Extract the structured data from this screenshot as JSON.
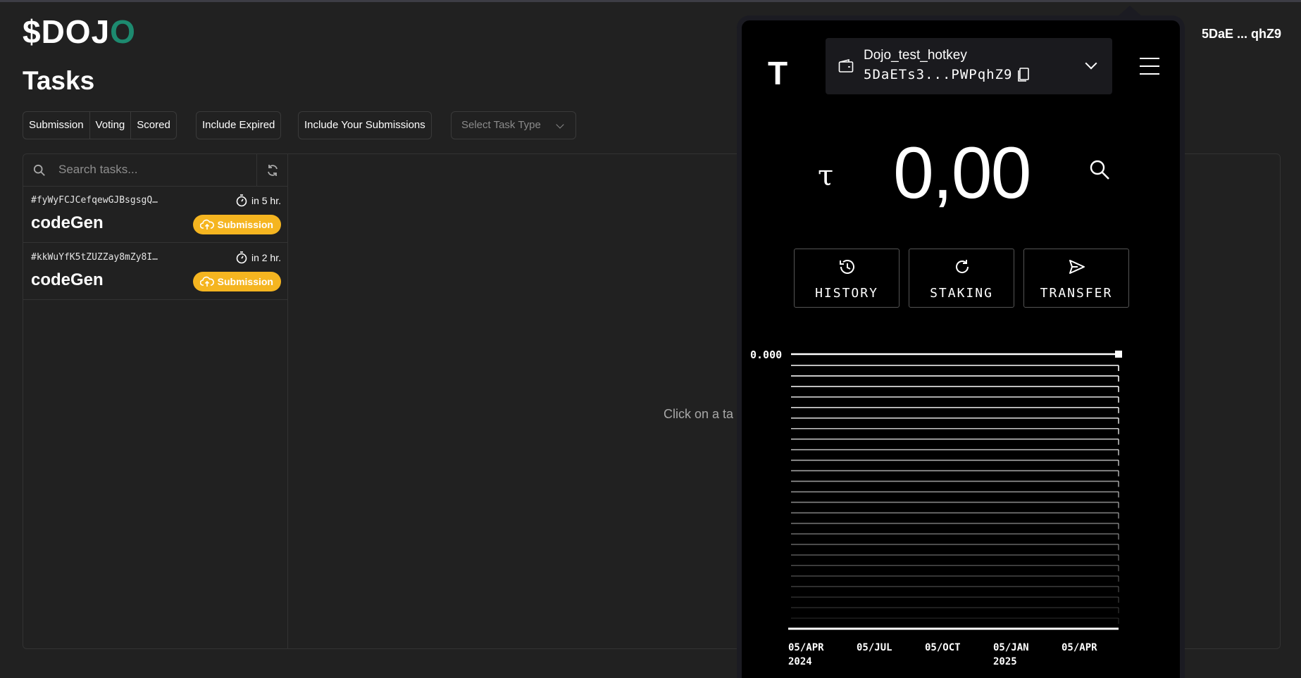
{
  "app": {
    "logo_main": "$DOJ",
    "logo_accent": "O"
  },
  "page": {
    "title": "Tasks",
    "empty_message": "Click on a ta"
  },
  "header": {
    "wallet_chip": "5DaE ... qhZ9"
  },
  "filters": {
    "segments": [
      "Submission",
      "Voting",
      "Scored"
    ],
    "include_expired": "Include Expired",
    "include_submissions": "Include Your Submissions",
    "task_type_placeholder": "Select Task Type"
  },
  "search": {
    "placeholder": "Search tasks..."
  },
  "tasks": [
    {
      "id": "#fyWyFCJCefqewGJBsgsgQ…",
      "due": "in 5 hr.",
      "name": "codeGen",
      "status": "Submission"
    },
    {
      "id": "#kkWuYfK5tZUZZay8mZy8I…",
      "due": "in 2 hr.",
      "name": "codeGen",
      "status": "Submission"
    }
  ],
  "wallet": {
    "logo": "T",
    "account_name": "Dojo_test_hotkey",
    "account_address": "5DaETs3...PWPqhZ9",
    "currency_symbol": "τ",
    "balance": "0,00",
    "actions": [
      "HISTORY",
      "STAKING",
      "TRANSFER"
    ],
    "colors": {
      "background": "#000000",
      "frame": "#1b1b22",
      "accent_badge": "#f5b520"
    }
  },
  "chart_data": {
    "type": "line",
    "y_tick_labels": [
      "0.000"
    ],
    "x_tick_labels": [
      [
        "05/APR",
        "2024"
      ],
      [
        "05/JUL",
        ""
      ],
      [
        "05/OCT",
        ""
      ],
      [
        "05/JAN",
        "2025"
      ],
      [
        "05/APR",
        ""
      ]
    ],
    "series": [
      {
        "values": [
          0,
          0,
          0,
          0,
          0
        ]
      }
    ],
    "grid": true
  }
}
